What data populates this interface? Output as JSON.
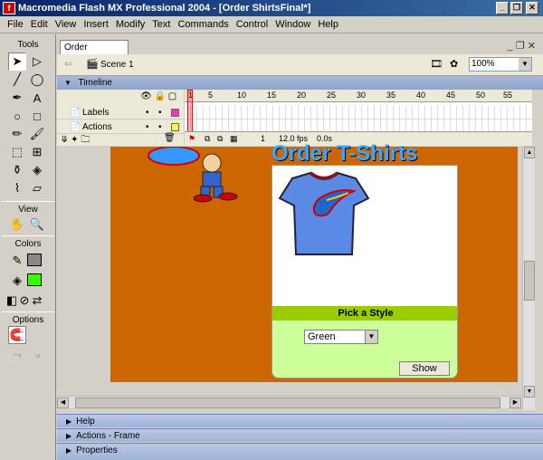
{
  "window": {
    "title": "Macromedia Flash MX Professional 2004 - [Order ShirtsFinal*]",
    "controls": {
      "minimize": "_",
      "restore": "❐",
      "close": "✕"
    }
  },
  "menu": [
    "File",
    "Edit",
    "View",
    "Insert",
    "Modify",
    "Text",
    "Commands",
    "Control",
    "Window",
    "Help"
  ],
  "tools": {
    "title": "Tools",
    "view_title": "View",
    "colors_title": "Colors",
    "options_title": "Options"
  },
  "document": {
    "tab": "Order ShirtsFinal*",
    "scene": "Scene 1",
    "zoom": "100%"
  },
  "timeline": {
    "title": "Timeline",
    "layers": [
      "Labels",
      "Actions"
    ],
    "ruler": [
      "1",
      "5",
      "10",
      "15",
      "20",
      "25",
      "30",
      "35",
      "40",
      "45",
      "50",
      "55"
    ],
    "status": {
      "frame": "1",
      "fps": "12.0 fps",
      "time": "0.0s"
    }
  },
  "stage": {
    "card_header": "Pick a Style",
    "style_value": "Green",
    "show_button": "Show",
    "banner_text": "Order T-Shirts"
  },
  "panels": [
    "Help",
    "Actions - Frame",
    "Properties"
  ],
  "colors": {
    "stage_bg": "#cc6600",
    "card_header": "#9acd00",
    "card_body": "#ccff99",
    "fill_color": "#33ff00"
  }
}
